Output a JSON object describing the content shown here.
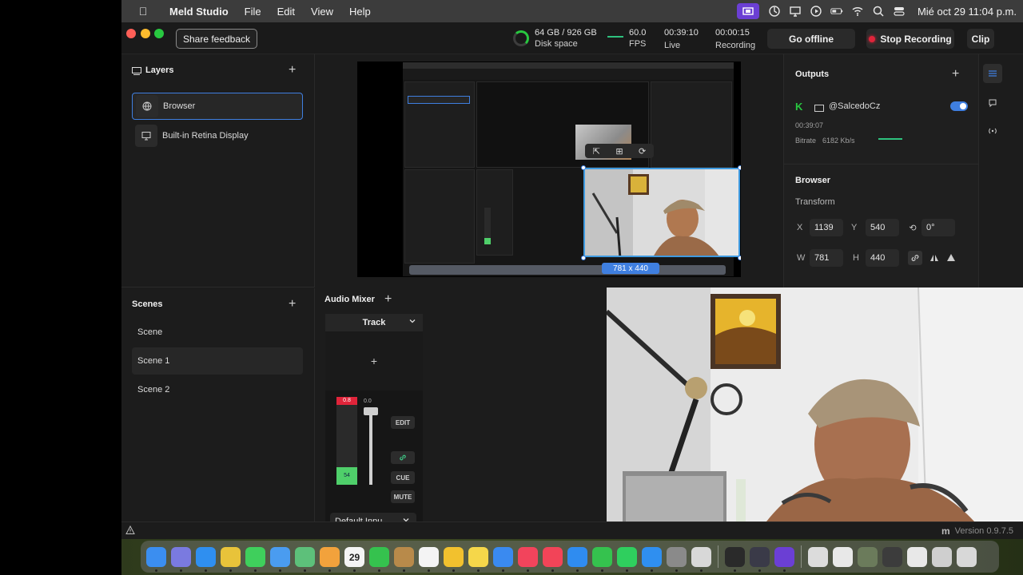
{
  "menubar": {
    "app_name": "Meld Studio",
    "menus": [
      "File",
      "Edit",
      "View",
      "Help"
    ],
    "clock": "Mié oct 29  11:04 p.m."
  },
  "toolbar": {
    "share_feedback": "Share feedback",
    "disk": "64 GB / 926 GB",
    "disk_label": "Disk space",
    "fps": "60.0",
    "fps_label": "FPS",
    "live_time": "00:39:10",
    "live_label": "Live",
    "rec_time": "00:00:15",
    "rec_label": "Recording",
    "go_offline": "Go offline",
    "stop_recording": "Stop Recording",
    "clip": "Clip"
  },
  "layers": {
    "title": "Layers",
    "items": [
      {
        "label": "Browser",
        "icon": "globe-icon",
        "selected": true
      },
      {
        "label": "Built-in Retina Display",
        "icon": "monitor-icon",
        "selected": false
      }
    ]
  },
  "preview": {
    "size_badge": "781 x 440"
  },
  "outputs": {
    "title": "Outputs",
    "account": "@SalcedoCz",
    "service_icon": "kick-icon",
    "elapsed": "00:39:07",
    "bitrate_label": "Bitrate",
    "bitrate_value": "6182 Kb/s",
    "enabled": true
  },
  "inspector": {
    "title": "Browser",
    "transform_label": "Transform",
    "x_label": "X",
    "x_value": "1139",
    "y_label": "Y",
    "y_value": "540",
    "rotation": "0°",
    "w_label": "W",
    "w_value": "781",
    "h_label": "H",
    "h_value": "440"
  },
  "scenes": {
    "title": "Scenes",
    "items": [
      {
        "label": "Scene",
        "selected": false
      },
      {
        "label": "Scene 1",
        "selected": true
      },
      {
        "label": "Scene 2",
        "selected": false
      }
    ]
  },
  "mixer": {
    "title": "Audio Mixer",
    "track_label": "Track",
    "peak": "0.8",
    "gain": "0.0",
    "level": "54",
    "edit": "EDIT",
    "cue": "CUE",
    "mute": "MUTE",
    "input": "Default Inpu..."
  },
  "status": {
    "version": "Version 0.9.7.5",
    "logo": "m"
  },
  "dock": {
    "apps": [
      {
        "name": "finder-icon",
        "color": "#3b8ef0"
      },
      {
        "name": "launchpad-icon",
        "color": "#7a7ae0"
      },
      {
        "name": "safari-icon",
        "color": "#2f8ff0"
      },
      {
        "name": "chrome-icon",
        "color": "#e8c33a"
      },
      {
        "name": "messages-icon",
        "color": "#3fcf5c"
      },
      {
        "name": "mail-icon",
        "color": "#4a9cf0"
      },
      {
        "name": "maps-icon",
        "color": "#5dc07a"
      },
      {
        "name": "photos-icon",
        "color": "#f2a23c"
      },
      {
        "name": "calendar-icon",
        "color": "#f4f4f4"
      },
      {
        "name": "facetime-icon",
        "color": "#35c24e"
      },
      {
        "name": "contacts-icon",
        "color": "#b88a4a"
      },
      {
        "name": "reminders-icon",
        "color": "#f4f4f4"
      },
      {
        "name": "freeform-icon",
        "color": "#f2c12e"
      },
      {
        "name": "notes-icon",
        "color": "#f5d74a"
      },
      {
        "name": "keynote-icon",
        "color": "#3a8af0"
      },
      {
        "name": "music-icon",
        "color": "#f2445c"
      },
      {
        "name": "news-icon",
        "color": "#f24458"
      },
      {
        "name": "keynote-blue-icon",
        "color": "#2f8cf0"
      },
      {
        "name": "numbers-icon",
        "color": "#35c24e"
      },
      {
        "name": "whatsapp-icon",
        "color": "#2fcf5e"
      },
      {
        "name": "appstore-icon",
        "color": "#2f8ff0"
      },
      {
        "name": "settings-icon",
        "color": "#8a8a8a"
      },
      {
        "name": "utility-icon",
        "color": "#d8d8d8"
      },
      {
        "name": "separator"
      },
      {
        "name": "obs-icon",
        "color": "#2a2a2a"
      },
      {
        "name": "meld-icon",
        "color": "#3a3a48"
      },
      {
        "name": "meld-studio-icon",
        "color": "#6b3fd4"
      },
      {
        "name": "separator"
      },
      {
        "name": "preview-icon",
        "color": "#dcdcdc"
      },
      {
        "name": "window-thumb-1-icon",
        "color": "#e8e8e8"
      },
      {
        "name": "window-thumb-2-icon",
        "color": "#6b7b5b"
      },
      {
        "name": "window-thumb-3-icon",
        "color": "#3c3c3c"
      },
      {
        "name": "window-thumb-4-icon",
        "color": "#e8e8e8"
      },
      {
        "name": "window-thumb-5-icon",
        "color": "#cfcfcf"
      },
      {
        "name": "trash-icon",
        "color": "#d8d8d8"
      }
    ],
    "calendar_day": "29"
  }
}
